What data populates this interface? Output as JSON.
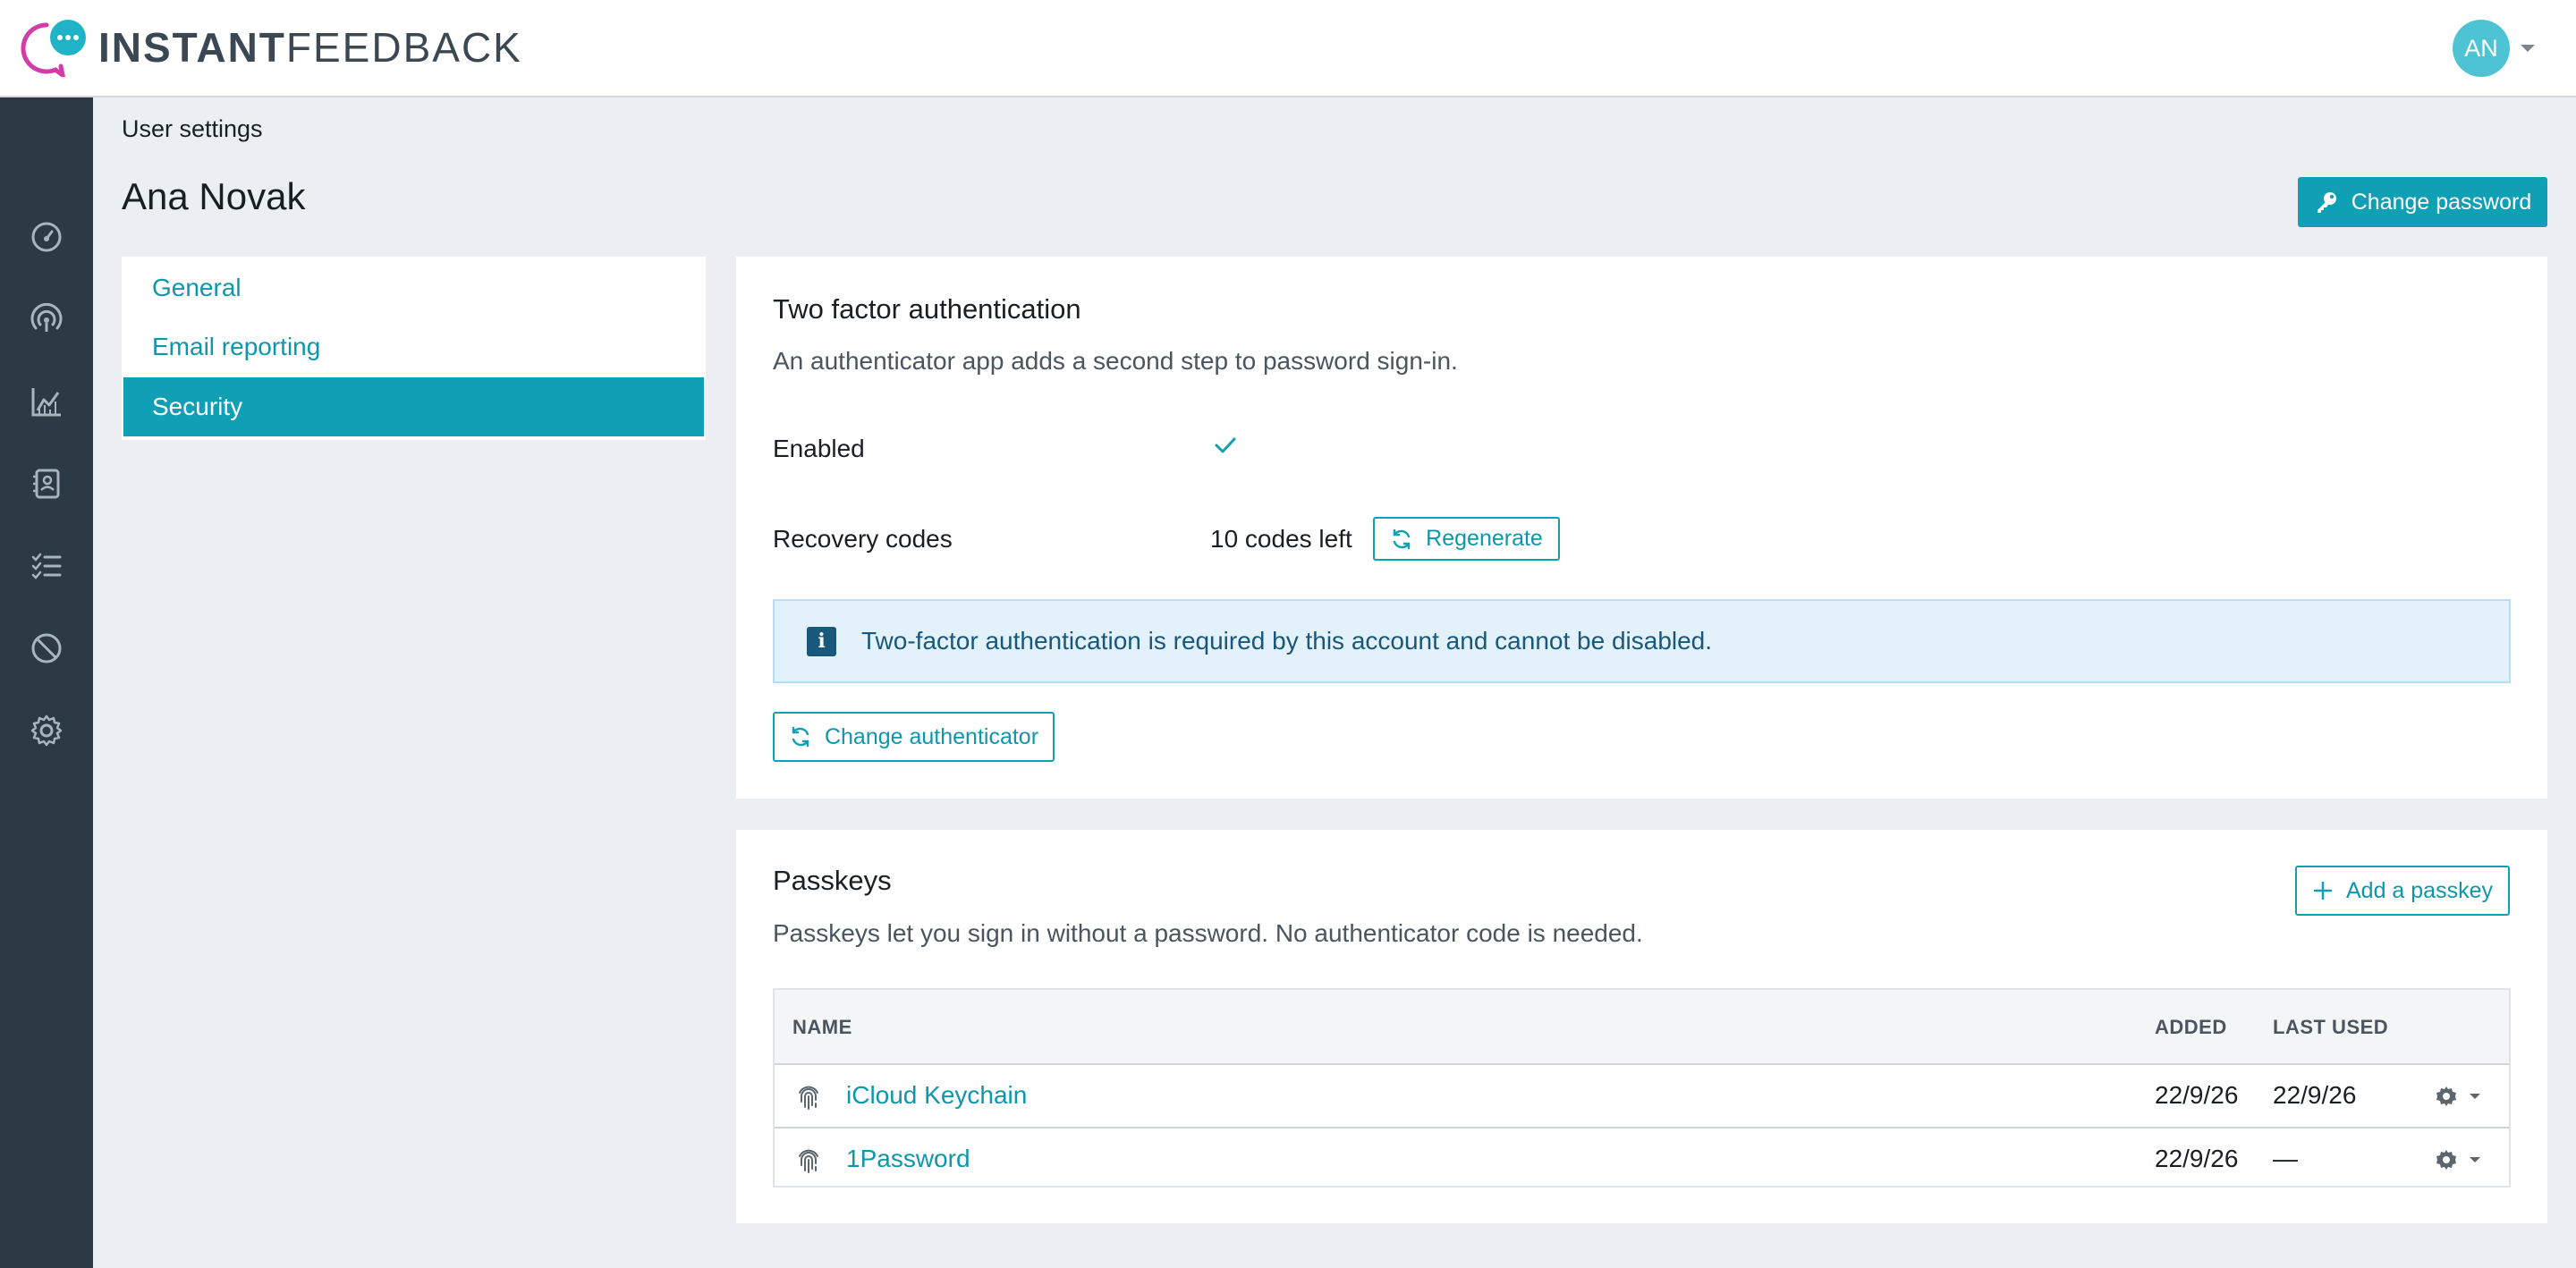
{
  "app": {
    "logo_text_bold": "INSTANT",
    "logo_text_light": "FEEDBACK",
    "brand_colors": {
      "accent": "#0fa0b5",
      "logo_pink": "#d23ca8",
      "logo_teal": "#1fb3c7",
      "sidebar": "#2b3a44"
    }
  },
  "user_menu": {
    "initials": "AN"
  },
  "sidebar": {
    "items": [
      {
        "icon": "dashboard-gauge-icon"
      },
      {
        "icon": "broadcast-icon"
      },
      {
        "icon": "analytics-chart-icon"
      },
      {
        "icon": "contacts-book-icon"
      },
      {
        "icon": "checklist-icon"
      },
      {
        "icon": "block-icon"
      },
      {
        "icon": "settings-gear-icon"
      }
    ]
  },
  "page": {
    "breadcrumb": "User settings",
    "title": "Ana Novak",
    "change_password_label": "Change password"
  },
  "settings_nav": {
    "items": [
      {
        "label": "General",
        "active": false
      },
      {
        "label": "Email reporting",
        "active": false
      },
      {
        "label": "Security",
        "active": true
      }
    ]
  },
  "two_factor": {
    "title": "Two factor authentication",
    "description": "An authenticator app adds a second step to password sign-in.",
    "enabled_label": "Enabled",
    "enabled_icon": "check-icon",
    "recovery_label": "Recovery codes",
    "recovery_value": "10 codes left",
    "regenerate_label": "Regenerate",
    "alert_text": "Two-factor authentication is required by this account and cannot be disabled.",
    "change_authenticator_label": "Change authenticator"
  },
  "passkeys": {
    "title": "Passkeys",
    "description": "Passkeys let you sign in without a password. No authenticator code is needed.",
    "add_label": "Add a passkey",
    "columns": {
      "name": "NAME",
      "added": "ADDED",
      "last_used": "LAST USED"
    },
    "rows": [
      {
        "name": "iCloud Keychain",
        "added": "22/9/26",
        "last_used": "22/9/26"
      },
      {
        "name": "1Password",
        "added": "22/9/26",
        "last_used": "—"
      }
    ]
  }
}
